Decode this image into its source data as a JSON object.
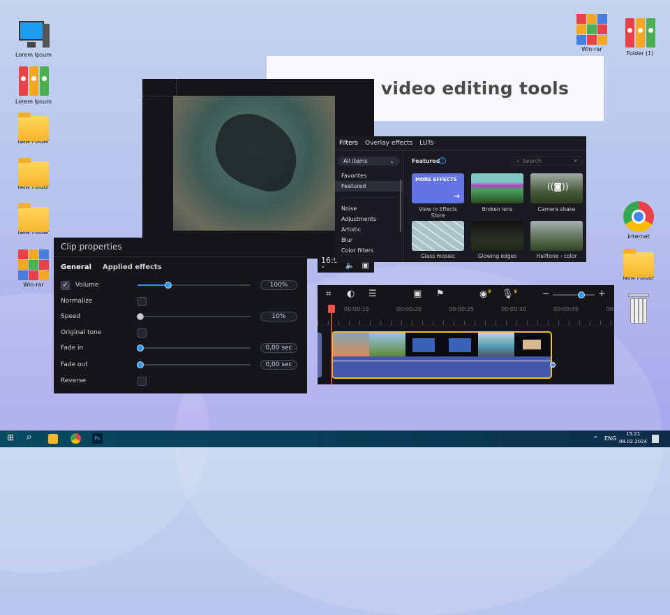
{
  "headline": "Built-in video editing tools",
  "desktop": {
    "left": [
      {
        "label": "Lorem Ipsum",
        "icon": "computer-icon"
      },
      {
        "label": "Lorem Ipsum",
        "icon": "binders-icon"
      },
      {
        "label": "New Folder",
        "icon": "folder-icon"
      },
      {
        "label": "New Folder",
        "icon": "folder-icon"
      },
      {
        "label": "New Folder",
        "icon": "folder-icon"
      },
      {
        "label": "Win-rar",
        "icon": "winrar-icon"
      }
    ],
    "right": [
      {
        "label": "Win-rar",
        "icon": "winrar-icon"
      },
      {
        "label": "Folder (1)",
        "icon": "binders-icon"
      },
      {
        "label": "Internet",
        "icon": "chrome-icon"
      },
      {
        "label": "New Folder",
        "icon": "folder-icon"
      },
      {
        "label": "",
        "icon": "recycle-bin-icon"
      }
    ]
  },
  "preview": {
    "aspect": "16:9 ˅"
  },
  "filters": {
    "tabs": [
      "Filters",
      "Overlay effects",
      "LUTs"
    ],
    "dropdown": "All items",
    "side_items": [
      "Favorites",
      "Featured",
      "Noise",
      "Adjustments",
      "Artistic",
      "Blur",
      "Color filters"
    ],
    "active": "Featured",
    "section_title": "Featured",
    "search_placeholder": "Search",
    "more_effects": "MORE EFFECTS",
    "items": [
      "View in Effects Store",
      "Broken lens",
      "Camera shake",
      "Glass mosaic",
      "Glowing edges",
      "Halftone - color"
    ]
  },
  "clip": {
    "title": "Clip properties",
    "tabs": [
      "General",
      "Applied effects"
    ],
    "volume": {
      "label": "Volume",
      "checked": true,
      "value": "100%",
      "level": 0.26
    },
    "normalize": "Normalize",
    "speed": {
      "label": "Speed",
      "value": "10%",
      "level": 0
    },
    "original_tone": "Original tone",
    "fade_in": {
      "label": "Fade in",
      "value": "0,00 sec",
      "level": 0
    },
    "fade_out": {
      "label": "Fade out",
      "value": "0,00 sec",
      "level": 0
    },
    "reverse": "Reverse"
  },
  "timeline": {
    "ticks": [
      "00:00:15",
      "00:00:20",
      "00:00:25",
      "00:00:30",
      "00:00:35",
      "00:"
    ],
    "zoom_level": 0.72
  },
  "taskbar": {
    "lang": "ENG",
    "time": "15:21",
    "date": "08.02.2024"
  },
  "colors": {
    "accent": "#2b9bf5",
    "clip_border": "#f3c21b",
    "more_effects": "#6474e5",
    "taskbar": "#074a60"
  }
}
